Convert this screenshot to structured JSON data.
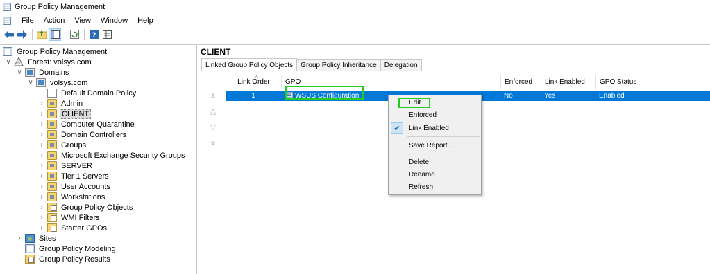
{
  "window": {
    "title": "Group Policy Management",
    "app_icon": "gpmc-icon"
  },
  "menu": {
    "items": [
      "File",
      "Action",
      "View",
      "Window",
      "Help"
    ]
  },
  "toolbar": {
    "buttons": [
      "back-icon",
      "forward-icon",
      "up-folder-icon",
      "show-hide-tree-icon",
      "refresh-icon",
      "help-icon",
      "properties-icon"
    ]
  },
  "tree": {
    "root": "Group Policy Management",
    "forest": "Forest: volsys.com",
    "domains": "Domains",
    "domain": "volsys.com",
    "items": [
      "Default Domain Policy",
      "Admin",
      "CLIENT",
      "Computer Quarantine",
      "Domain Controllers",
      "Groups",
      "Microsoft Exchange Security Groups",
      "SERVER",
      "Tier 1 Servers",
      "User Accounts",
      "Workstations",
      "Group Policy Objects",
      "WMI Filters",
      "Starter GPOs"
    ],
    "sites": "Sites",
    "modeling": "Group Policy Modeling",
    "results": "Group Policy Results",
    "selected": "CLIENT"
  },
  "content": {
    "title": "CLIENT",
    "tabs": [
      "Linked Group Policy Objects",
      "Group Policy Inheritance",
      "Delegation"
    ],
    "active_tab": "Linked Group Policy Objects",
    "columns": [
      "Link Order",
      "GPO",
      "Enforced",
      "Link Enabled",
      "GPO Status"
    ],
    "rows": [
      {
        "link_order": "1",
        "gpo": "WSUS Configuration",
        "enforced": "No",
        "link_enabled": "Yes",
        "gpo_status": "Enabled"
      }
    ]
  },
  "context_menu": {
    "items": [
      "Edit",
      "Enforced",
      "Link Enabled",
      "Save Report...",
      "Delete",
      "Rename",
      "Refresh"
    ],
    "checked": "Link Enabled",
    "highlighted": "Edit"
  },
  "colors": {
    "selection": "#0078d7",
    "highlight_box": "#22cc22"
  }
}
